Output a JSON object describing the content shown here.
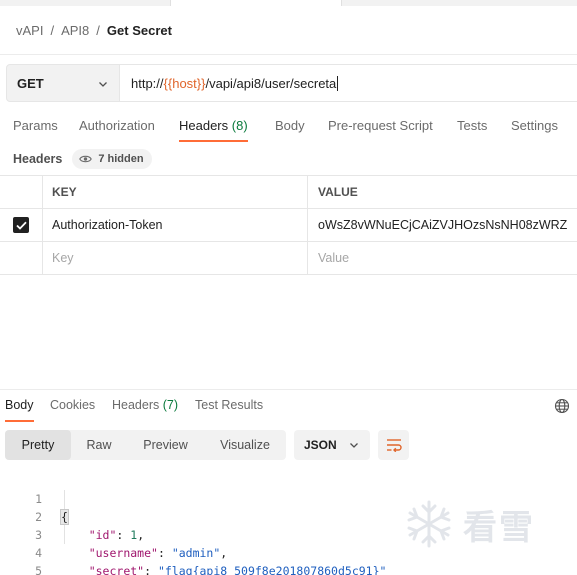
{
  "breadcrumb": {
    "items": [
      "vAPI",
      "API8"
    ],
    "separator": "/",
    "current": "Get Secret"
  },
  "request": {
    "method": "GET",
    "url_prefix": "http://",
    "url_variable": "{{host}}",
    "url_suffix": "/vapi/api8/user/secreta"
  },
  "request_tabs": {
    "params": "Params",
    "authorization": "Authorization",
    "headers": "Headers",
    "headers_count": "(8)",
    "body": "Body",
    "pre_request": "Pre-request Script",
    "tests": "Tests",
    "settings": "Settings",
    "active": "headers"
  },
  "headers_section": {
    "title": "Headers",
    "hidden_label": "7 hidden"
  },
  "headers_table": {
    "columns": {
      "key": "KEY",
      "value": "VALUE"
    },
    "rows": [
      {
        "checked": true,
        "key": "Authorization-Token",
        "value": "oWsZ8vWNuECjCAiZVJHOzsNsNH08zWRZ"
      }
    ],
    "placeholder": {
      "key": "Key",
      "value": "Value"
    }
  },
  "response_tabs": {
    "body": "Body",
    "cookies": "Cookies",
    "headers": "Headers",
    "headers_count": "(7)",
    "test_results": "Test Results",
    "active": "body"
  },
  "view_modes": {
    "pretty": "Pretty",
    "raw": "Raw",
    "preview": "Preview",
    "visualize": "Visualize",
    "active": "pretty"
  },
  "format": "JSON",
  "response_body": {
    "line_numbers": [
      "1",
      "2",
      "3",
      "4",
      "5"
    ],
    "open_brace": "{",
    "close_brace": "}",
    "fields": [
      {
        "key": "\"id\"",
        "value": "1",
        "type": "number",
        "trailing": ","
      },
      {
        "key": "\"username\"",
        "value": "\"admin\"",
        "type": "string",
        "trailing": ","
      },
      {
        "key": "\"secret\"",
        "value": "\"flag{api8_509f8e201807860d5c91}\"",
        "type": "string",
        "trailing": ""
      }
    ]
  },
  "watermark": {
    "text": "看雪",
    "icon": "snowflake-logo-icon"
  },
  "colors": {
    "accent": "#ff6c37",
    "variable": "#e0652b",
    "count": "#0a7a3c",
    "json_key": "#a0176e",
    "json_string": "#1f5fbf",
    "json_number": "#1f7a5c"
  },
  "icons": {
    "method_dropdown": "chevron-down-icon",
    "hidden_headers": "eye-icon",
    "checkbox": "checkbox-checked-icon",
    "language": "globe-icon",
    "format_dropdown": "chevron-down-icon",
    "wrap": "wrap-lines-icon"
  }
}
